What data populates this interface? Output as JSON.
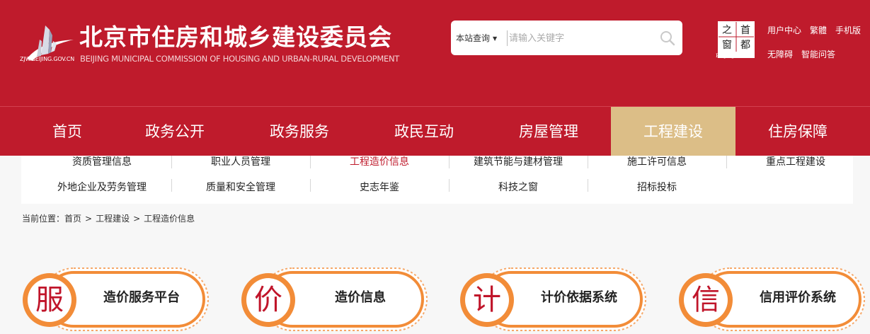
{
  "header": {
    "logo_domain": "ZJW.BEIJING.GOV.CN",
    "title": "北京市住房和城乡建设委员会",
    "subtitle": "BEIJING MUNICIPAL COMMISSION OF HOUSING AND URBAN-RURAL DEVELOPMENT",
    "capital_logo": {
      "chars": [
        "之",
        "首",
        "窗",
        "都"
      ],
      "caption": "Beijing·China"
    },
    "links": [
      "用户中心",
      "繁體",
      "手机版",
      "无障碍",
      "智能问答"
    ]
  },
  "search": {
    "scope_label": "本站查询",
    "placeholder": "请输入关键字",
    "value": ""
  },
  "nav": {
    "items": [
      "首页",
      "政务公开",
      "政务服务",
      "政民互动",
      "房屋管理",
      "工程建设",
      "住房保障"
    ],
    "active": "工程建设"
  },
  "subnav": {
    "row1": [
      "资质管理信息",
      "职业人员管理",
      "工程造价信息",
      "建筑节能与建材管理",
      "施工许可信息",
      "重点工程建设"
    ],
    "row2": [
      "外地企业及劳务管理",
      "质量和安全管理",
      "史志年鉴",
      "科技之窗",
      "招标投标"
    ],
    "active": "工程造价信息"
  },
  "breadcrumb": {
    "prefix": "当前位置：",
    "items": [
      "首页",
      "工程建设",
      "工程造价信息"
    ],
    "separator": ">"
  },
  "cards": [
    {
      "char": "服",
      "label": "造价服务平台"
    },
    {
      "char": "价",
      "label": "造价信息"
    },
    {
      "char": "计",
      "label": "计价依据系统"
    },
    {
      "char": "信",
      "label": "信用评价系统"
    }
  ],
  "colors": {
    "brand_red": "#bf1b2c",
    "active_gold": "#dcbe87",
    "card_orange": "#f28c38"
  }
}
